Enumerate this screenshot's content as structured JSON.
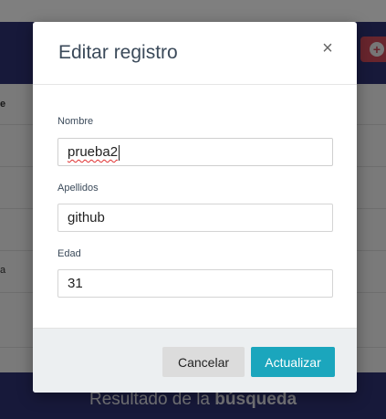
{
  "background": {
    "row_fragments": [
      "e",
      "a"
    ],
    "footer_title_light": "Resultado de la ",
    "footer_title_bold": "búsqueda",
    "add_icon": "plus-circle-icon"
  },
  "modal": {
    "title": "Editar registro",
    "close_symbol": "×",
    "fields": {
      "nombre": {
        "label": "Nombre",
        "value": "prueba2"
      },
      "apellidos": {
        "label": "Apellidos",
        "value": "github"
      },
      "edad": {
        "label": "Edad",
        "value": "31"
      }
    },
    "buttons": {
      "cancel": "Cancelar",
      "update": "Actualizar"
    }
  },
  "colors": {
    "header_navy": "#2f3275",
    "primary_teal": "#1ba6bd",
    "danger_red": "#d14a5b"
  }
}
